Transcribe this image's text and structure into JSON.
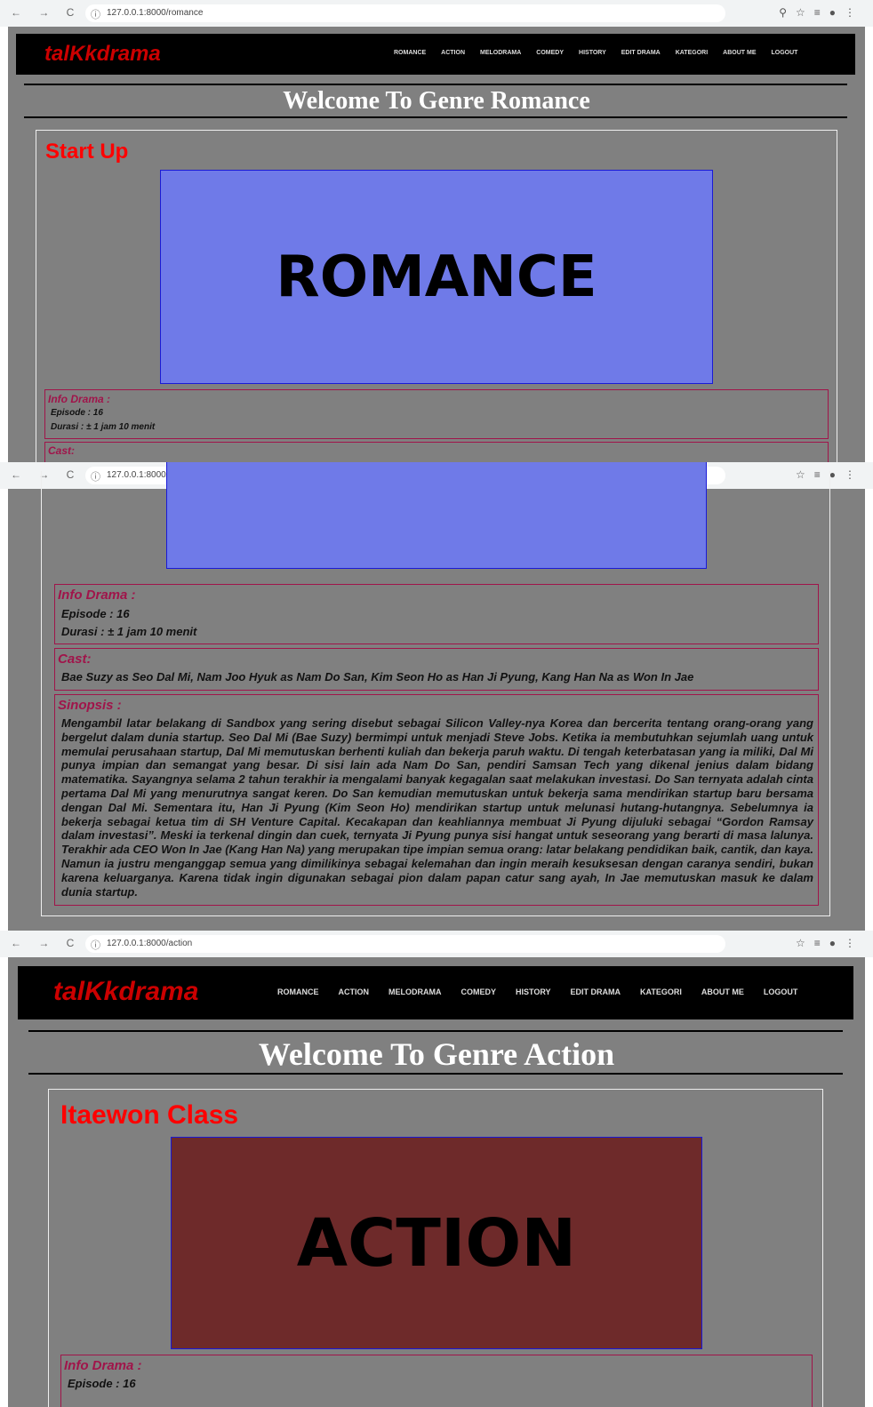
{
  "browser": {
    "nav_glyphs": "← → C",
    "info_icon": "info-icon",
    "tabs": [
      {
        "url": "127.0.0.1:8000/romance"
      },
      {
        "url": "127.0.0.1:8000/romance"
      },
      {
        "url": "127.0.0.1:8000/action"
      }
    ]
  },
  "nav": {
    "brand": "talKkdrama",
    "items": [
      "ROMANCE",
      "ACTION",
      "MELODRAMA",
      "COMEDY",
      "HISTORY",
      "EDIT DRAMA",
      "KATEGORI",
      "ABOUT ME",
      "LOGOUT"
    ]
  },
  "romance": {
    "welcome": "Welcome To Genre Romance",
    "drama_title": "Start Up",
    "banner_text": "ROMANCE",
    "banner_color": "#6f7ae8",
    "info_label": "Info Drama :",
    "episode": "Episode : 16",
    "durasi": "Durasi : ± 1 jam 10 menit",
    "cast_label": "Cast:",
    "cast": "Bae Suzy as Seo Dal Mi, Nam Joo Hyuk as Nam Do San, Kim Seon Ho as Han Ji Pyung, Kang Han Na as Won In Jae",
    "sinopsis_label": "Sinopsis :",
    "sinopsis": "Mengambil latar belakang di Sandbox yang sering disebut sebagai Silicon Valley-nya Korea dan bercerita tentang orang-orang yang bergelut dalam dunia startup. Seo Dal Mi (Bae Suzy) bermimpi untuk menjadi Steve Jobs. Ketika ia membutuhkan sejumlah uang untuk memulai perusahaan startup, Dal Mi memutuskan berhenti kuliah dan bekerja paruh waktu. Di tengah keterbatasan yang ia miliki, Dal Mi punya impian dan semangat yang besar. Di sisi lain ada Nam Do San, pendiri Samsan Tech yang dikenal jenius dalam bidang matematika. Sayangnya selama 2 tahun terakhir ia mengalami banyak kegagalan saat melakukan investasi. Do San ternyata adalah cinta pertama Dal Mi yang menurutnya sangat keren. Do San kemudian memutuskan untuk bekerja sama mendirikan startup baru bersama dengan Dal Mi. Sementara itu, Han Ji Pyung (Kim Seon Ho) mendirikan startup untuk melunasi hutang-hutangnya. Sebelumnya ia bekerja sebagai ketua tim di SH Venture Capital. Kecakapan dan keahliannya membuat Ji Pyung dijuluki sebagai “Gordon Ramsay dalam investasi”. Meski ia terkenal dingin dan cuek, ternyata Ji Pyung punya sisi hangat untuk seseorang yang berarti di masa lalunya. Terakhir ada CEO Won In Jae (Kang Han Na) yang merupakan tipe impian semua orang: latar belakang pendidikan baik, cantik, dan kaya. Namun ia justru menganggap semua yang dimilikinya sebagai kelemahan dan ingin meraih kesuksesan dengan caranya sendiri, bukan karena keluarganya. Karena tidak ingin digunakan sebagai pion dalam papan catur sang ayah, In Jae memutuskan masuk ke dalam dunia startup."
  },
  "action": {
    "welcome": "Welcome To Genre Action",
    "drama_title": "Itaewon Class",
    "banner_text": "ACTION",
    "banner_color": "#6e2a2a",
    "info_label": "Info Drama :",
    "episode": "Episode : 16"
  }
}
